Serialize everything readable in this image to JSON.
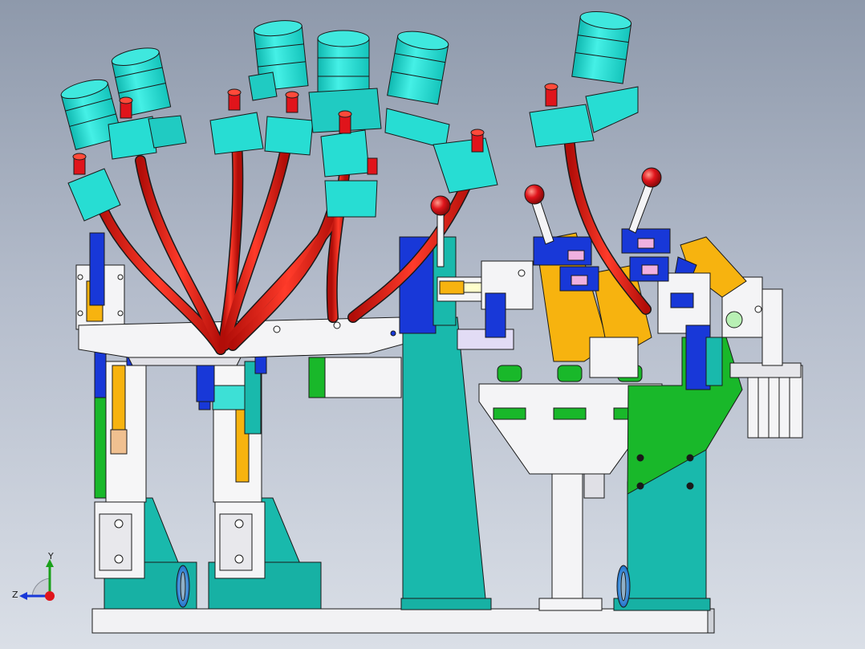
{
  "viewport": {
    "background_top": "#8e99ab",
    "background_bottom": "#dadfe7"
  },
  "model": {
    "description_colors": {
      "clamp_arm": "#d91c10",
      "cylinder": "#27ddd3",
      "block_blue": "#1838d8",
      "frame_teal": "#19b9ac",
      "plate_white": "#f4f4f6",
      "bracket_yellow": "#f7b30f",
      "support_green": "#19b82a",
      "ball_handle": "#e0141b",
      "outline": "#1a1a1a"
    }
  },
  "triad": {
    "y_label": "Y",
    "z_label": "Z"
  }
}
